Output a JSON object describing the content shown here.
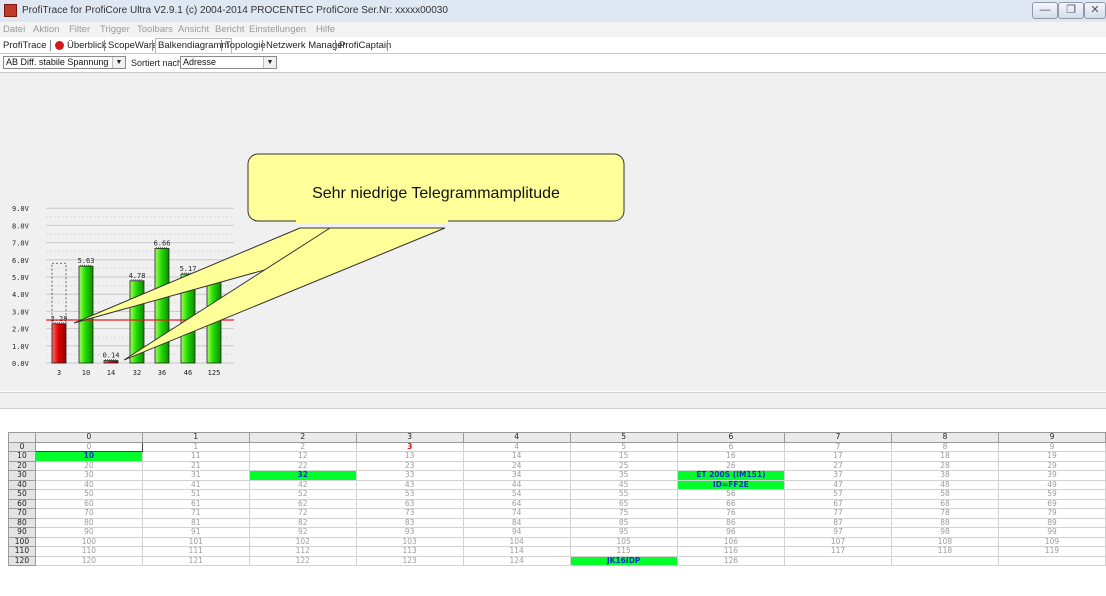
{
  "window": {
    "title": "ProfiTrace for ProfiCore Ultra V2.9.1 (c) 2004-2014 PROCENTEC  ProfiCore Ser.Nr: xxxxx00030",
    "controls": [
      "minimize",
      "restore",
      "close"
    ]
  },
  "menu": [
    "Datei",
    "Aktion",
    "Filter",
    "Trigger",
    "Toolbars",
    "Ansicht",
    "Bericht",
    "Einstellungen",
    "Hilfe"
  ],
  "tabs": [
    "ProfiTrace",
    "Überblick",
    "ScopeWare",
    "Balkendiagramm",
    "Topologie",
    "Netzwerk Manager",
    "ProfiCaptain"
  ],
  "active_tab": "Balkendiagramm",
  "toolbar": {
    "measure_select": "AB Diff. stabile Spannung",
    "sort_label": "Sortiert nach:",
    "sort_select": "Adresse"
  },
  "callout": "Sehr niedrige Telegrammamplitude",
  "colors": {
    "bar_green": "#22dd00",
    "bar_red": "#e00000",
    "threshold": "#e02020",
    "callout_fill": "#ffff99"
  },
  "chart_data": {
    "type": "bar",
    "categories": [
      "3",
      "10",
      "14",
      "32",
      "36",
      "46",
      "125"
    ],
    "values": [
      2.28,
      5.63,
      0.14,
      4.78,
      6.66,
      5.17,
      4.9
    ],
    "value_labels": [
      "2.28",
      "5.63",
      "0.14",
      "4.78",
      "6.66",
      "5.17",
      ""
    ],
    "max_marker_station": "3",
    "max_marker_value": 5.8,
    "threshold": 2.5,
    "ylim": [
      0,
      9
    ],
    "yticks": [
      "0.0V",
      "1.0V",
      "2.0V",
      "3.0V",
      "4.0V",
      "5.0V",
      "6.0V",
      "7.0V",
      "8.0V",
      "9.0V"
    ],
    "grid": true
  },
  "grid": {
    "columns": [
      "0",
      "1",
      "2",
      "3",
      "4",
      "5",
      "6",
      "7",
      "8",
      "9"
    ],
    "row_headers": [
      "0",
      "10",
      "20",
      "30",
      "40",
      "50",
      "60",
      "70",
      "80",
      "90",
      "100",
      "110",
      "120"
    ],
    "highlighted": {
      "3": "3",
      "10": "10",
      "32": "32",
      "36": "ET 200S (IM151)",
      "46": "ID=FF2E",
      "125": "JK16IDP"
    }
  }
}
